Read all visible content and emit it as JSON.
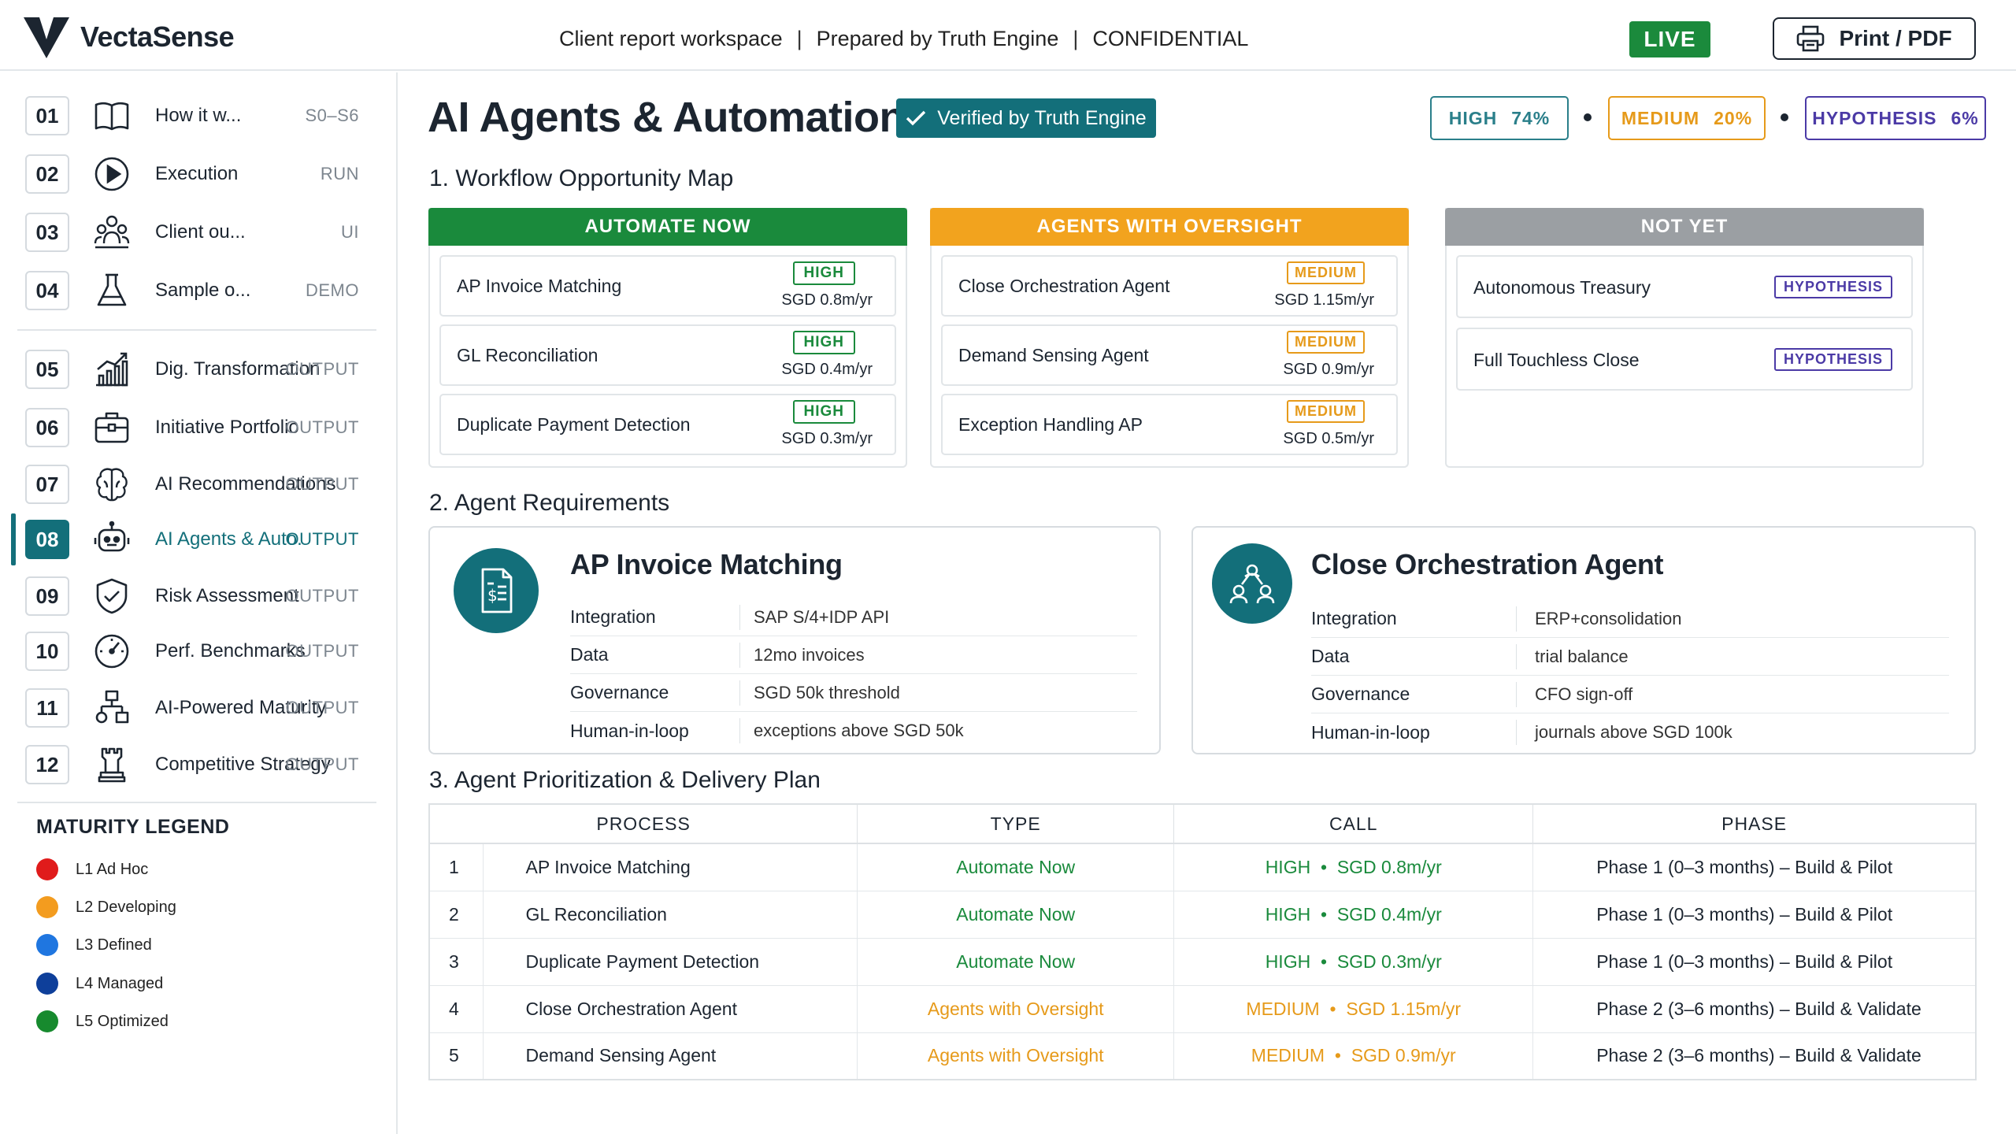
{
  "header": {
    "brand": "VectaSense",
    "meta": [
      "Client report workspace",
      "Prepared by Truth Engine",
      "CONFIDENTIAL"
    ],
    "meta_separator": "|",
    "live_label": "LIVE",
    "print_label": "Print / PDF"
  },
  "sidebar": {
    "items": [
      {
        "num": "01",
        "label": "How it w...",
        "tag": "S0–S6",
        "icon": "book-icon"
      },
      {
        "num": "02",
        "label": "Execution",
        "tag": "RUN",
        "icon": "play-icon"
      },
      {
        "num": "03",
        "label": "Client ou...",
        "tag": "UI",
        "icon": "users-icon"
      },
      {
        "num": "04",
        "label": "Sample o...",
        "tag": "DEMO",
        "icon": "flask-icon"
      },
      {
        "num": "05",
        "label": "Dig. Transformation",
        "tag": "OUTPUT",
        "icon": "chart-growth-icon"
      },
      {
        "num": "06",
        "label": "Initiative Portfolio",
        "tag": "OUTPUT",
        "icon": "briefcase-icon"
      },
      {
        "num": "07",
        "label": "AI Recommendations",
        "tag": "OUTPUT",
        "icon": "brain-icon"
      },
      {
        "num": "08",
        "label": "AI Agents & Auto.",
        "tag": "OUTPUT",
        "icon": "robot-icon",
        "active": true
      },
      {
        "num": "09",
        "label": "Risk Assessment",
        "tag": "OUTPUT",
        "icon": "shield-icon"
      },
      {
        "num": "10",
        "label": "Perf. Benchmarks",
        "tag": "OUTPUT",
        "icon": "gauge-icon"
      },
      {
        "num": "11",
        "label": "AI-Powered Maturity",
        "tag": "OUTPUT",
        "icon": "hierarchy-icon"
      },
      {
        "num": "12",
        "label": "Competitive Strategy",
        "tag": "OUTPUT",
        "icon": "chess-rook-icon"
      }
    ],
    "legend": {
      "title": "MATURITY LEGEND",
      "items": [
        {
          "label": "L1 Ad Hoc",
          "color": "#e01b1b"
        },
        {
          "label": "L2 Developing",
          "color": "#f39c1f"
        },
        {
          "label": "L3 Defined",
          "color": "#1f76e0"
        },
        {
          "label": "L4 Managed",
          "color": "#0e3f9a"
        },
        {
          "label": "L5 Optimized",
          "color": "#178a2e"
        }
      ]
    }
  },
  "main": {
    "title": "AI Agents & Automation",
    "verified_label": "Verified by Truth Engine",
    "confidence": [
      {
        "label": "HIGH",
        "value": "74%",
        "color": "#2a7f8a"
      },
      {
        "label": "MEDIUM",
        "value": "20%",
        "color": "#e69a1a"
      },
      {
        "label": "HYPOTHESIS",
        "value": "6%",
        "color": "#4b3aa6"
      }
    ],
    "workflow": {
      "title": "1. Workflow Opportunity Map",
      "columns": [
        {
          "heading": "AUTOMATE NOW",
          "color": "#1a8a3c",
          "cards": [
            {
              "name": "AP Invoice Matching",
              "badge": "HIGH",
              "value": "SGD 0.8m/yr"
            },
            {
              "name": "GL Reconciliation",
              "badge": "HIGH",
              "value": "SGD 0.4m/yr"
            },
            {
              "name": "Duplicate Payment Detection",
              "badge": "HIGH",
              "value": "SGD 0.3m/yr"
            }
          ]
        },
        {
          "heading": "AGENTS WITH OVERSIGHT",
          "color": "#f2a31e",
          "cards": [
            {
              "name": "Close Orchestration Agent",
              "badge": "MEDIUM",
              "value": "SGD 1.15m/yr"
            },
            {
              "name": "Demand Sensing Agent",
              "badge": "MEDIUM",
              "value": "SGD 0.9m/yr"
            },
            {
              "name": "Exception Handling AP",
              "badge": "MEDIUM",
              "value": "SGD 0.5m/yr"
            }
          ]
        },
        {
          "heading": "NOT YET",
          "color": "#9b9fa3",
          "cards": [
            {
              "name": "Autonomous Treasury",
              "badge": "HYPOTHESIS",
              "value": ""
            },
            {
              "name": "Full Touchless Close",
              "badge": "HYPOTHESIS",
              "value": ""
            }
          ]
        }
      ]
    },
    "requirements": {
      "title": "2. Agent Requirements",
      "cards": [
        {
          "title": "AP Invoice Matching",
          "icon": "invoice-icon",
          "rows": [
            {
              "key": "Integration",
              "value": "SAP S/4+IDP API"
            },
            {
              "key": "Data",
              "value": "12mo invoices"
            },
            {
              "key": "Governance",
              "value": "SGD 50k threshold"
            },
            {
              "key": "Human-in-loop",
              "value": "exceptions above SGD 50k"
            }
          ]
        },
        {
          "title": "Close Orchestration Agent",
          "icon": "network-users-icon",
          "rows": [
            {
              "key": "Integration",
              "value": "ERP+consolidation"
            },
            {
              "key": "Data",
              "value": "trial balance"
            },
            {
              "key": "Governance",
              "value": "CFO sign-off"
            },
            {
              "key": "Human-in-loop",
              "value": "journals above SGD 100k"
            }
          ]
        }
      ]
    },
    "plan": {
      "title": "3. Agent Prioritization & Delivery Plan",
      "headers": [
        "PROCESS",
        "TYPE",
        "CALL",
        "PHASE"
      ],
      "rows": [
        {
          "idx": "1",
          "process": "AP Invoice Matching",
          "type": "Automate Now",
          "conf": "HIGH",
          "value": "SGD 0.8m/yr",
          "phase": "Phase 1 (0–3 months) – Build & Pilot",
          "color": "#1a8a3c"
        },
        {
          "idx": "2",
          "process": "GL Reconciliation",
          "type": "Automate Now",
          "conf": "HIGH",
          "value": "SGD 0.4m/yr",
          "phase": "Phase 1 (0–3 months) – Build & Pilot",
          "color": "#1a8a3c"
        },
        {
          "idx": "3",
          "process": "Duplicate Payment Detection",
          "type": "Automate Now",
          "conf": "HIGH",
          "value": "SGD 0.3m/yr",
          "phase": "Phase 1 (0–3 months) – Build & Pilot",
          "color": "#1a8a3c"
        },
        {
          "idx": "4",
          "process": "Close Orchestration Agent",
          "type": "Agents with Oversight",
          "conf": "MEDIUM",
          "value": "SGD 1.15m/yr",
          "phase": "Phase 2 (3–6 months) – Build & Validate",
          "color": "#e69a1a"
        },
        {
          "idx": "5",
          "process": "Demand Sensing Agent",
          "type": "Agents with Oversight",
          "conf": "MEDIUM",
          "value": "SGD 0.9m/yr",
          "phase": "Phase 2 (3–6 months) – Build & Validate",
          "color": "#e69a1a"
        }
      ]
    }
  }
}
